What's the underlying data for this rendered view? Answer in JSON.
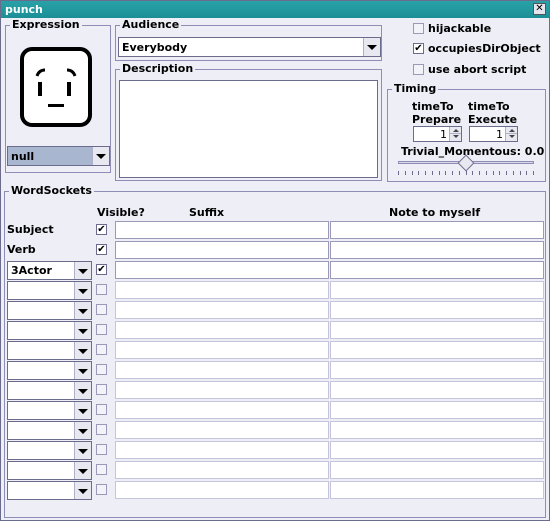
{
  "window": {
    "title": "punch",
    "close_symbol": "✕"
  },
  "expression": {
    "title": "Expression",
    "value": "null"
  },
  "audience": {
    "title": "Audience",
    "value": "Everybody"
  },
  "description": {
    "title": "Description",
    "value": ""
  },
  "options": {
    "hijackable": {
      "label": "hijackable",
      "checked": false
    },
    "occupies": {
      "label": "occupiesDirObject",
      "checked": true
    },
    "abort": {
      "label": "use abort script",
      "checked": false
    }
  },
  "timing": {
    "title": "Timing",
    "prepare_label1": "timeTo",
    "prepare_label2": "Prepare",
    "prepare_value": "1",
    "execute_label1": "timeTo",
    "execute_label2": "Execute",
    "execute_value": "1",
    "trivial_label": "Trivial_Momentous: 0.0",
    "trivial_level": 0.5
  },
  "wordsockets": {
    "title": "WordSockets",
    "headers": {
      "visible": "Visible?",
      "suffix": "Suffix",
      "note": "Note to myself"
    },
    "rows": [
      {
        "type": "label",
        "label": "Subject",
        "visible": true
      },
      {
        "type": "label",
        "label": "Verb",
        "visible": true
      },
      {
        "type": "combo",
        "label": "3Actor",
        "visible": true
      },
      {
        "type": "combo",
        "label": "",
        "visible": false
      },
      {
        "type": "combo",
        "label": "",
        "visible": false
      },
      {
        "type": "combo",
        "label": "",
        "visible": false
      },
      {
        "type": "combo",
        "label": "",
        "visible": false
      },
      {
        "type": "combo",
        "label": "",
        "visible": false
      },
      {
        "type": "combo",
        "label": "",
        "visible": false
      },
      {
        "type": "combo",
        "label": "",
        "visible": false
      },
      {
        "type": "combo",
        "label": "",
        "visible": false
      },
      {
        "type": "combo",
        "label": "",
        "visible": false
      },
      {
        "type": "combo",
        "label": "",
        "visible": false
      },
      {
        "type": "combo",
        "label": "",
        "visible": false
      }
    ]
  },
  "check_symbol": "✔"
}
